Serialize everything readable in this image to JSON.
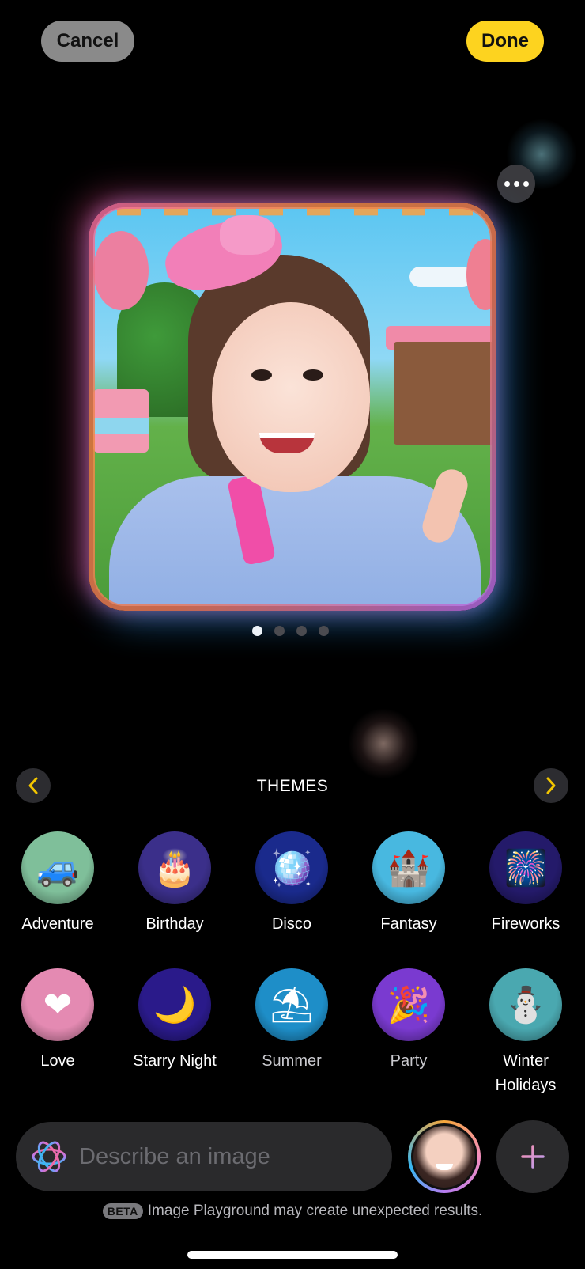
{
  "header": {
    "cancel_label": "Cancel",
    "done_label": "Done",
    "more_icon": "ellipsis-icon"
  },
  "preview": {
    "description": "Generated image: cartoon woman with pink bow at a garden party",
    "pages": 4,
    "current_page": 1
  },
  "themes": {
    "title": "THEMES",
    "prev_icon": "chevron-left-icon",
    "next_icon": "chevron-right-icon",
    "items": [
      {
        "label": "Adventure",
        "glyph": "🚙",
        "bg": "#7fbf9a",
        "dim": false
      },
      {
        "label": "Birthday",
        "glyph": "🎂",
        "bg": "#3b2f8a",
        "dim": false
      },
      {
        "label": "Disco",
        "glyph": "🪩",
        "bg": "#1a2a8c",
        "dim": false
      },
      {
        "label": "Fantasy",
        "glyph": "🏰",
        "bg": "#48b8e0",
        "dim": false
      },
      {
        "label": "Fireworks",
        "glyph": "🎆",
        "bg": "#241a6a",
        "dim": false
      },
      {
        "label": "Love",
        "glyph": "❤",
        "bg": "#e48ab2",
        "dim": false
      },
      {
        "label": "Starry Night",
        "glyph": "🌙",
        "bg": "#2a1a8a",
        "dim": false
      },
      {
        "label": "Summer",
        "glyph": "⛱",
        "bg": "#1e8ec8",
        "dim": true
      },
      {
        "label": "Party",
        "glyph": "🎉",
        "bg": "#7a3ad0",
        "dim": true
      },
      {
        "label": "Winter Holidays",
        "glyph": "⛄",
        "bg": "#4aa8b0",
        "dim": false
      }
    ]
  },
  "prompt": {
    "placeholder": "Describe an image",
    "value": ""
  },
  "footer": {
    "beta_label": "BETA",
    "disclaimer": "Image Playground may create unexpected results."
  }
}
